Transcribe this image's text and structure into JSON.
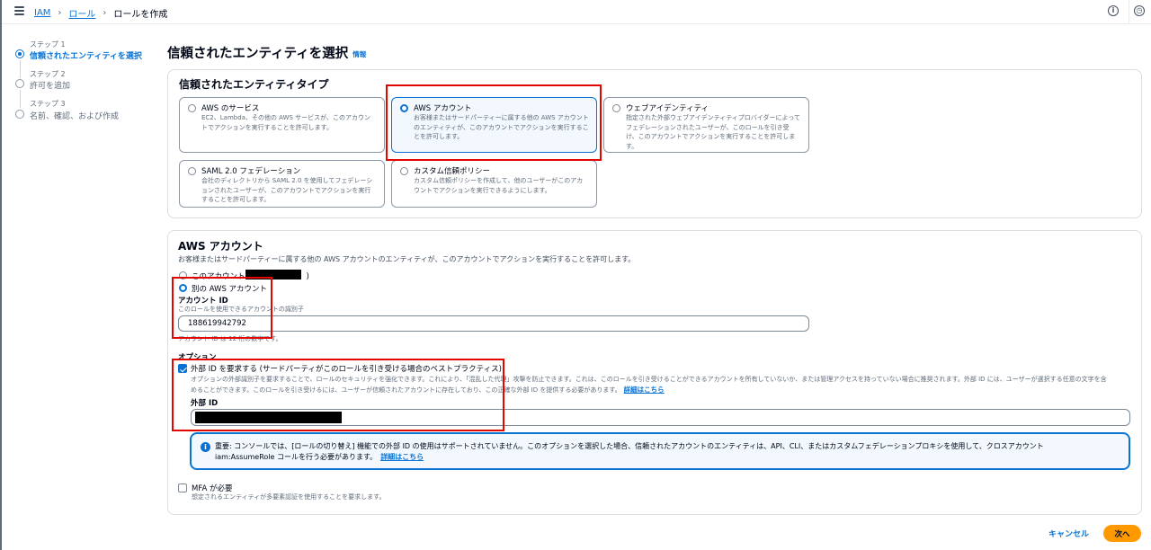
{
  "topbar": {
    "breadcrumb": [
      "IAM",
      "ロール",
      "ロールを作成"
    ],
    "info_icon": "info-icon",
    "settings_icon": "history-icon"
  },
  "steps": [
    {
      "step_label": "ステップ 1",
      "title": "信頼されたエンティティを選択",
      "active": true
    },
    {
      "step_label": "ステップ 2",
      "title": "許可を追加",
      "active": false
    },
    {
      "step_label": "ステップ 3",
      "title": "名前、確認、および作成",
      "active": false
    }
  ],
  "page": {
    "title": "信頼されたエンティティを選択",
    "info_link": "情報"
  },
  "entity_types": {
    "title": "信頼されたエンティティタイプ",
    "options": [
      {
        "title": "AWS のサービス",
        "description": "EC2、Lambda、その他の AWS サービスが、このアカウントでアクションを実行することを許可します。",
        "selected": false
      },
      {
        "title": "AWS アカウント",
        "description": "お客様またはサードパーティーに属する他の AWS アカウントのエンティティが、このアカウントでアクションを実行することを許可します。",
        "selected": true
      },
      {
        "title": "ウェブアイデンティティ",
        "description": "指定された外部ウェブアイデンティティプロバイダーによってフェデレーションされたユーザーが、このロールを引き受け、このアカウントでアクションを実行することを許可します。",
        "selected": false
      },
      {
        "title": "SAML 2.0 フェデレーション",
        "description": "会社のディレクトリから SAML 2.0 を使用してフェデレーションされたユーザーが、このアカウントでアクションを実行することを許可します。",
        "selected": false
      },
      {
        "title": "カスタム信頼ポリシー",
        "description": "カスタム信頼ポリシーを作成して、他のユーザーがこのアカウントでアクションを実行できるようにします。",
        "selected": false
      }
    ]
  },
  "aws_account": {
    "title": "AWS アカウント",
    "description": "お客様またはサードパーティーに属する他の AWS アカウントのエンティティが、このアカウントでアクションを実行することを許可します。",
    "this_account_label": "このアカウント (",
    "this_account_suffix": ")",
    "other_account_label": "別の AWS アカウント",
    "account_id_label": "アカウント ID",
    "account_id_hint": "このロールを使用できるアカウントの識別子",
    "account_id_value": "188619942792",
    "account_id_constraint": "アカウント ID は 12 桁の数字です。",
    "options_label": "オプション",
    "external_id_checkbox_label": "外部 ID を要求する (サードパーティがこのロールを引き受ける場合のベストプラクティス)",
    "external_id_desc_line1": "オプションの外部識別子を要求することで、ロールのセキュリティを強化できます。これにより、「混乱した代理」攻撃を防止できます。これは、このロールを引き受けることができるアカウントを所有していないか、または管理アクセスを持っていない場合に推奨されます。外部 ID には、ユーザーが選択する任意の文字を含",
    "external_id_desc_line2": "めることができます。このロールを引き受けるには、ユーザーが信頼されたアカウントに存在しており、この正確な外部 ID を提供する必要があります。",
    "learn_more": "詳細はこちら",
    "external_id_label": "外部 ID",
    "alert_text_line1": "重要: コンソールでは、[ロールの切り替え] 機能での外部 ID の使用はサポートされていません。このオプションを選択した場合、信頼されたアカウントのエンティティは、API、CLI、またはカスタムフェデレーションプロキシを使用して、クロスアカウント",
    "alert_text_line2": "iam:AssumeRole コールを行う必要があります。",
    "alert_link": "詳細はこちら",
    "mfa_label": "MFA が必要",
    "mfa_desc": "想定されるエンティティが多要素認証を使用することを要求します。"
  },
  "footer": {
    "cancel": "キャンセル",
    "next": "次へ"
  }
}
